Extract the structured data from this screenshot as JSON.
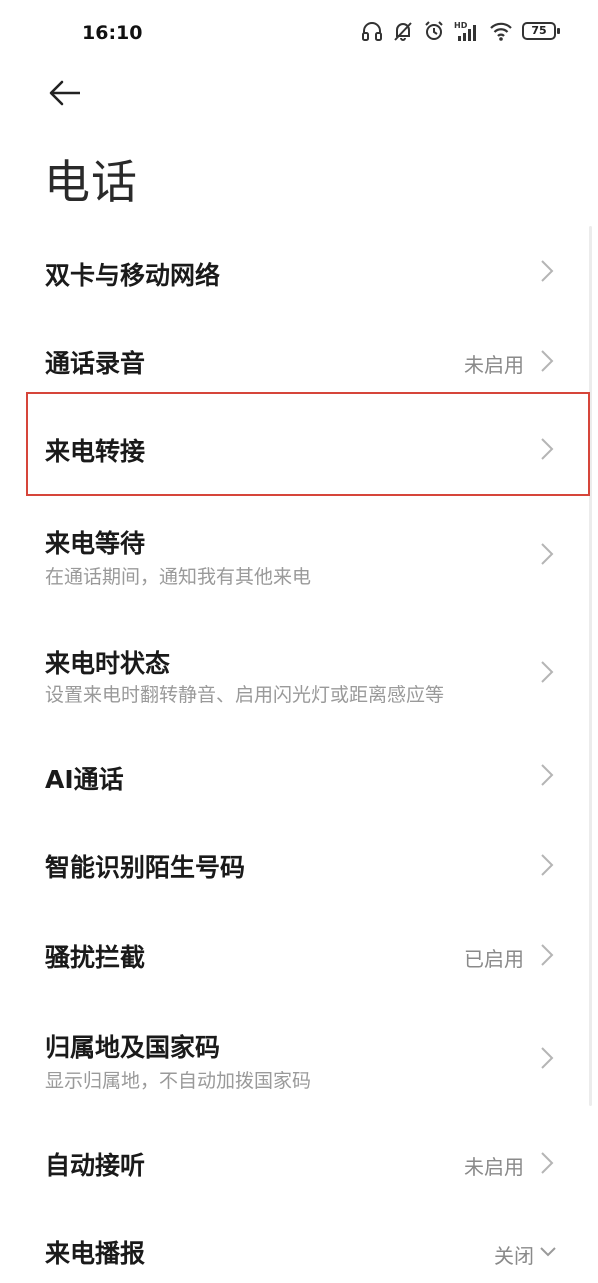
{
  "status_bar": {
    "time": "16:10",
    "battery": "75",
    "icons": [
      "headphones-icon",
      "mute-bell-icon",
      "alarm-icon",
      "hd-signal-icon",
      "wifi-icon",
      "battery-icon"
    ]
  },
  "header": {
    "back_icon": "back-arrow-icon",
    "title": "电话"
  },
  "settings": [
    {
      "title": "双卡与移动网络",
      "subtitle": "",
      "value": ""
    },
    {
      "title": "通话录音",
      "subtitle": "",
      "value": "未启用"
    },
    {
      "title": "来电转接",
      "subtitle": "",
      "value": ""
    },
    {
      "title": "来电等待",
      "subtitle": "在通话期间，通知我有其他来电",
      "value": ""
    },
    {
      "title": "来电时状态",
      "subtitle": "设置来电时翻转静音、启用闪光灯或距离感应等",
      "value": ""
    },
    {
      "title": "AI通话",
      "subtitle": "",
      "value": ""
    },
    {
      "title": "智能识别陌生号码",
      "subtitle": "",
      "value": ""
    },
    {
      "title": "骚扰拦截",
      "subtitle": "",
      "value": "已启用"
    },
    {
      "title": "归属地及国家码",
      "subtitle": "显示归属地，不自动加拨国家码",
      "value": ""
    },
    {
      "title": "自动接听",
      "subtitle": "",
      "value": "未启用"
    },
    {
      "title": "来电播报",
      "subtitle": "",
      "value": "关闭"
    }
  ],
  "colors": {
    "highlight_border": "#d6453a",
    "subtitle_text": "#9a9a9a",
    "value_text": "#8a8a8a"
  }
}
